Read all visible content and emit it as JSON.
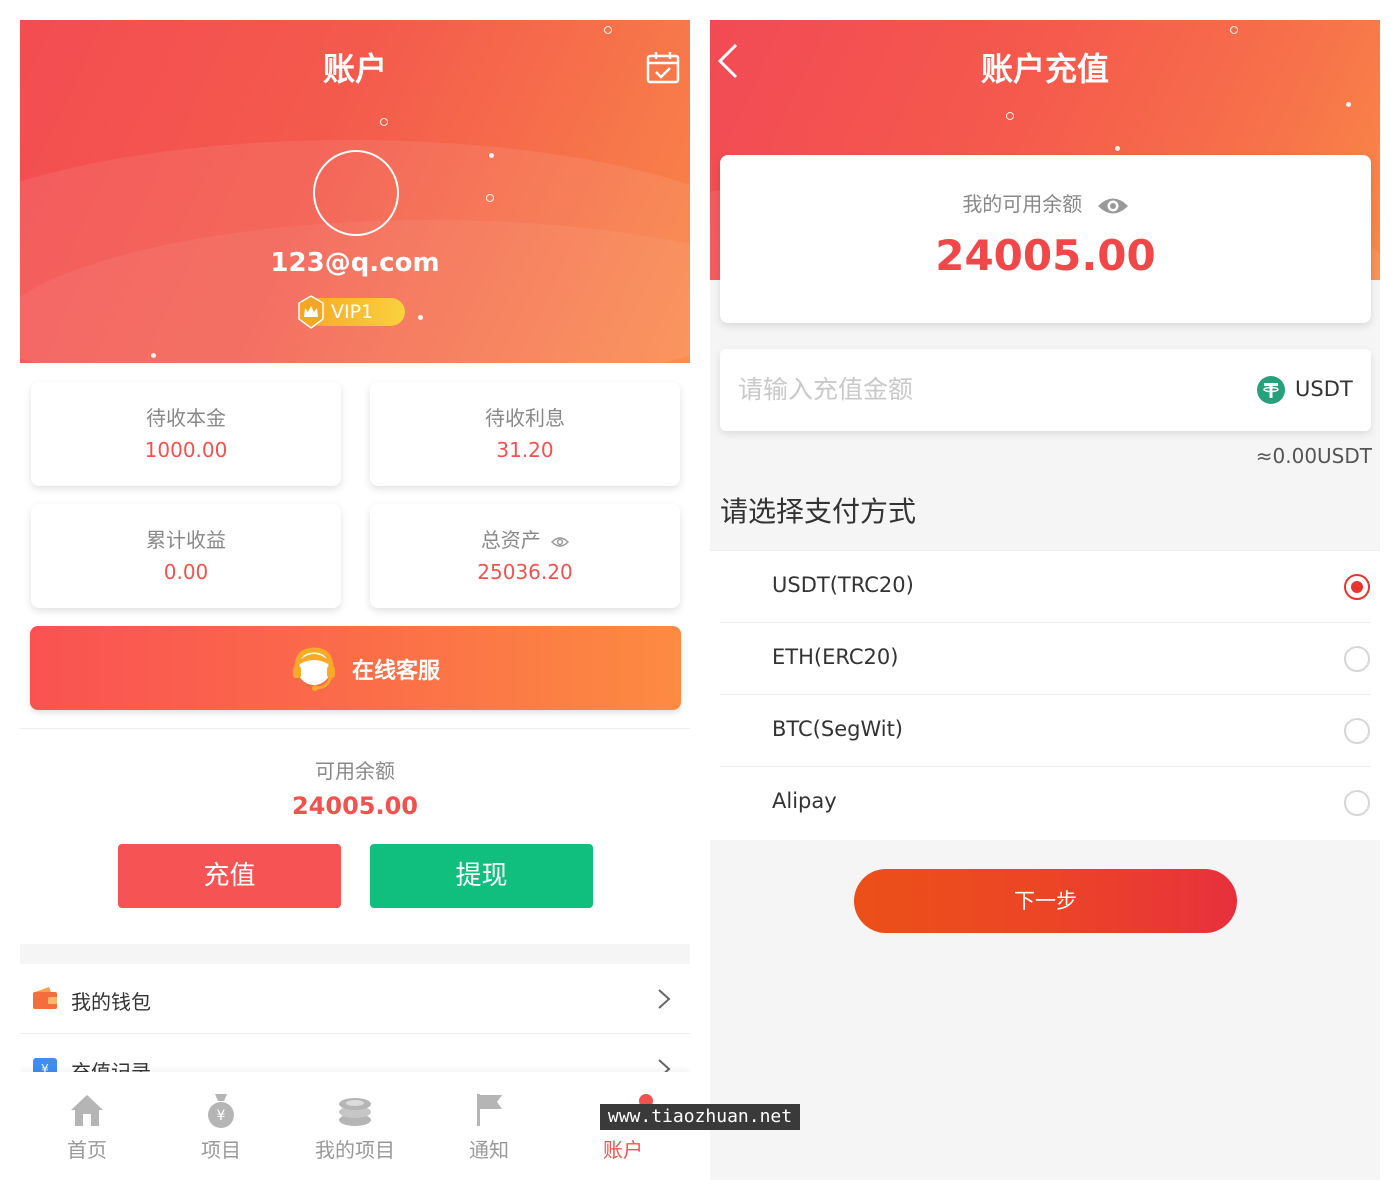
{
  "account": {
    "title": "账户",
    "email": "123@q.com",
    "vip_level": "VIP1",
    "stats": [
      {
        "label": "待收本金",
        "value": "1000.00"
      },
      {
        "label": "待收利息",
        "value": "31.20"
      },
      {
        "label": "累计收益",
        "value": "0.00"
      },
      {
        "label": "总资产",
        "value": "25036.20"
      }
    ],
    "service_label": "在线客服",
    "balance_label": "可用余额",
    "balance_value": "24005.00",
    "recharge_label": "充值",
    "withdraw_label": "提现",
    "menu": [
      {
        "label": "我的钱包",
        "icon": "wallet-icon"
      },
      {
        "label": "充值记录",
        "icon": "recharge-record-icon"
      }
    ],
    "tabs": [
      {
        "label": "首页",
        "icon": "home-icon"
      },
      {
        "label": "项目",
        "icon": "money-bag-icon"
      },
      {
        "label": "我的项目",
        "icon": "coin-stack-icon"
      },
      {
        "label": "通知",
        "icon": "flag-icon"
      },
      {
        "label": "账户",
        "icon": "account-icon",
        "active": true
      }
    ],
    "watermark": "www.tiaozhuan.net"
  },
  "recharge": {
    "title": "账户充值",
    "available_label": "我的可用余额",
    "available_value": "24005.00",
    "amount_placeholder": "请输入充值金额",
    "currency": "USDT",
    "approx": "≈0.00USDT",
    "pay_title": "请选择支付方式",
    "methods": [
      {
        "label": "USDT(TRC20)",
        "selected": true
      },
      {
        "label": "ETH(ERC20)",
        "selected": false
      },
      {
        "label": "BTC(SegWit)",
        "selected": false
      },
      {
        "label": "Alipay",
        "selected": false
      }
    ],
    "next_label": "下一步"
  },
  "colors": {
    "accent_red": "#f2524e",
    "withdraw_green": "#10bf7d",
    "header_gradient_start": "#f34c52",
    "header_gradient_end": "#fa8747"
  }
}
